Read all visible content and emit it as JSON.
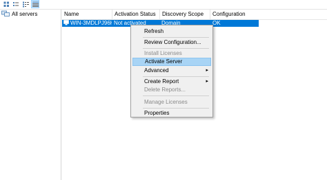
{
  "toolbar": {
    "buttons": [
      {
        "icon": "large-icons-view-icon"
      },
      {
        "icon": "small-icons-view-icon"
      },
      {
        "icon": "list-view-icon"
      },
      {
        "icon": "details-view-icon",
        "active": true
      }
    ]
  },
  "tree": {
    "root_label": "All servers"
  },
  "list": {
    "columns": [
      "Name",
      "Activation Status",
      "Discovery Scope",
      "Configuration"
    ],
    "rows": [
      {
        "name": "WIN-3MDLPJ96H...",
        "activation_status": "Not activated",
        "discovery_scope": "Domain",
        "configuration": "OK",
        "selected": true
      }
    ]
  },
  "context_menu": {
    "items": [
      {
        "label": "Refresh",
        "enabled": true
      },
      {
        "label": "Review Configuration...",
        "enabled": true
      },
      {
        "label": "Install Licenses",
        "enabled": false
      },
      {
        "label": "Activate Server",
        "enabled": true,
        "highlighted": true
      },
      {
        "label": "Advanced",
        "enabled": true,
        "submenu": true
      },
      {
        "label": "Create Report",
        "enabled": true,
        "submenu": true
      },
      {
        "label": "Delete Reports...",
        "enabled": false
      },
      {
        "label": "Manage Licenses",
        "enabled": false
      },
      {
        "label": "Properties",
        "enabled": true
      }
    ]
  },
  "colors": {
    "selection": "#0078d7",
    "menu_highlight": "#a8d4f5",
    "menu_background": "#f0f0f0",
    "disabled_text": "#8a8a8a"
  }
}
